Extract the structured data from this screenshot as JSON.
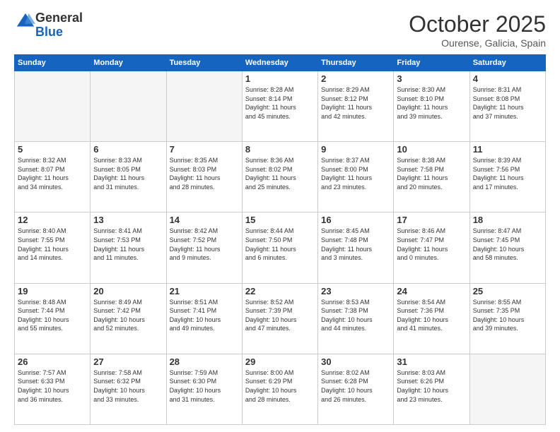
{
  "logo": {
    "general": "General",
    "blue": "Blue"
  },
  "header": {
    "month": "October 2025",
    "location": "Ourense, Galicia, Spain"
  },
  "weekdays": [
    "Sunday",
    "Monday",
    "Tuesday",
    "Wednesday",
    "Thursday",
    "Friday",
    "Saturday"
  ],
  "weeks": [
    [
      {
        "day": "",
        "info": ""
      },
      {
        "day": "",
        "info": ""
      },
      {
        "day": "",
        "info": ""
      },
      {
        "day": "1",
        "info": "Sunrise: 8:28 AM\nSunset: 8:14 PM\nDaylight: 11 hours\nand 45 minutes."
      },
      {
        "day": "2",
        "info": "Sunrise: 8:29 AM\nSunset: 8:12 PM\nDaylight: 11 hours\nand 42 minutes."
      },
      {
        "day": "3",
        "info": "Sunrise: 8:30 AM\nSunset: 8:10 PM\nDaylight: 11 hours\nand 39 minutes."
      },
      {
        "day": "4",
        "info": "Sunrise: 8:31 AM\nSunset: 8:08 PM\nDaylight: 11 hours\nand 37 minutes."
      }
    ],
    [
      {
        "day": "5",
        "info": "Sunrise: 8:32 AM\nSunset: 8:07 PM\nDaylight: 11 hours\nand 34 minutes."
      },
      {
        "day": "6",
        "info": "Sunrise: 8:33 AM\nSunset: 8:05 PM\nDaylight: 11 hours\nand 31 minutes."
      },
      {
        "day": "7",
        "info": "Sunrise: 8:35 AM\nSunset: 8:03 PM\nDaylight: 11 hours\nand 28 minutes."
      },
      {
        "day": "8",
        "info": "Sunrise: 8:36 AM\nSunset: 8:02 PM\nDaylight: 11 hours\nand 25 minutes."
      },
      {
        "day": "9",
        "info": "Sunrise: 8:37 AM\nSunset: 8:00 PM\nDaylight: 11 hours\nand 23 minutes."
      },
      {
        "day": "10",
        "info": "Sunrise: 8:38 AM\nSunset: 7:58 PM\nDaylight: 11 hours\nand 20 minutes."
      },
      {
        "day": "11",
        "info": "Sunrise: 8:39 AM\nSunset: 7:56 PM\nDaylight: 11 hours\nand 17 minutes."
      }
    ],
    [
      {
        "day": "12",
        "info": "Sunrise: 8:40 AM\nSunset: 7:55 PM\nDaylight: 11 hours\nand 14 minutes."
      },
      {
        "day": "13",
        "info": "Sunrise: 8:41 AM\nSunset: 7:53 PM\nDaylight: 11 hours\nand 11 minutes."
      },
      {
        "day": "14",
        "info": "Sunrise: 8:42 AM\nSunset: 7:52 PM\nDaylight: 11 hours\nand 9 minutes."
      },
      {
        "day": "15",
        "info": "Sunrise: 8:44 AM\nSunset: 7:50 PM\nDaylight: 11 hours\nand 6 minutes."
      },
      {
        "day": "16",
        "info": "Sunrise: 8:45 AM\nSunset: 7:48 PM\nDaylight: 11 hours\nand 3 minutes."
      },
      {
        "day": "17",
        "info": "Sunrise: 8:46 AM\nSunset: 7:47 PM\nDaylight: 11 hours\nand 0 minutes."
      },
      {
        "day": "18",
        "info": "Sunrise: 8:47 AM\nSunset: 7:45 PM\nDaylight: 10 hours\nand 58 minutes."
      }
    ],
    [
      {
        "day": "19",
        "info": "Sunrise: 8:48 AM\nSunset: 7:44 PM\nDaylight: 10 hours\nand 55 minutes."
      },
      {
        "day": "20",
        "info": "Sunrise: 8:49 AM\nSunset: 7:42 PM\nDaylight: 10 hours\nand 52 minutes."
      },
      {
        "day": "21",
        "info": "Sunrise: 8:51 AM\nSunset: 7:41 PM\nDaylight: 10 hours\nand 49 minutes."
      },
      {
        "day": "22",
        "info": "Sunrise: 8:52 AM\nSunset: 7:39 PM\nDaylight: 10 hours\nand 47 minutes."
      },
      {
        "day": "23",
        "info": "Sunrise: 8:53 AM\nSunset: 7:38 PM\nDaylight: 10 hours\nand 44 minutes."
      },
      {
        "day": "24",
        "info": "Sunrise: 8:54 AM\nSunset: 7:36 PM\nDaylight: 10 hours\nand 41 minutes."
      },
      {
        "day": "25",
        "info": "Sunrise: 8:55 AM\nSunset: 7:35 PM\nDaylight: 10 hours\nand 39 minutes."
      }
    ],
    [
      {
        "day": "26",
        "info": "Sunrise: 7:57 AM\nSunset: 6:33 PM\nDaylight: 10 hours\nand 36 minutes."
      },
      {
        "day": "27",
        "info": "Sunrise: 7:58 AM\nSunset: 6:32 PM\nDaylight: 10 hours\nand 33 minutes."
      },
      {
        "day": "28",
        "info": "Sunrise: 7:59 AM\nSunset: 6:30 PM\nDaylight: 10 hours\nand 31 minutes."
      },
      {
        "day": "29",
        "info": "Sunrise: 8:00 AM\nSunset: 6:29 PM\nDaylight: 10 hours\nand 28 minutes."
      },
      {
        "day": "30",
        "info": "Sunrise: 8:02 AM\nSunset: 6:28 PM\nDaylight: 10 hours\nand 26 minutes."
      },
      {
        "day": "31",
        "info": "Sunrise: 8:03 AM\nSunset: 6:26 PM\nDaylight: 10 hours\nand 23 minutes."
      },
      {
        "day": "",
        "info": ""
      }
    ]
  ]
}
